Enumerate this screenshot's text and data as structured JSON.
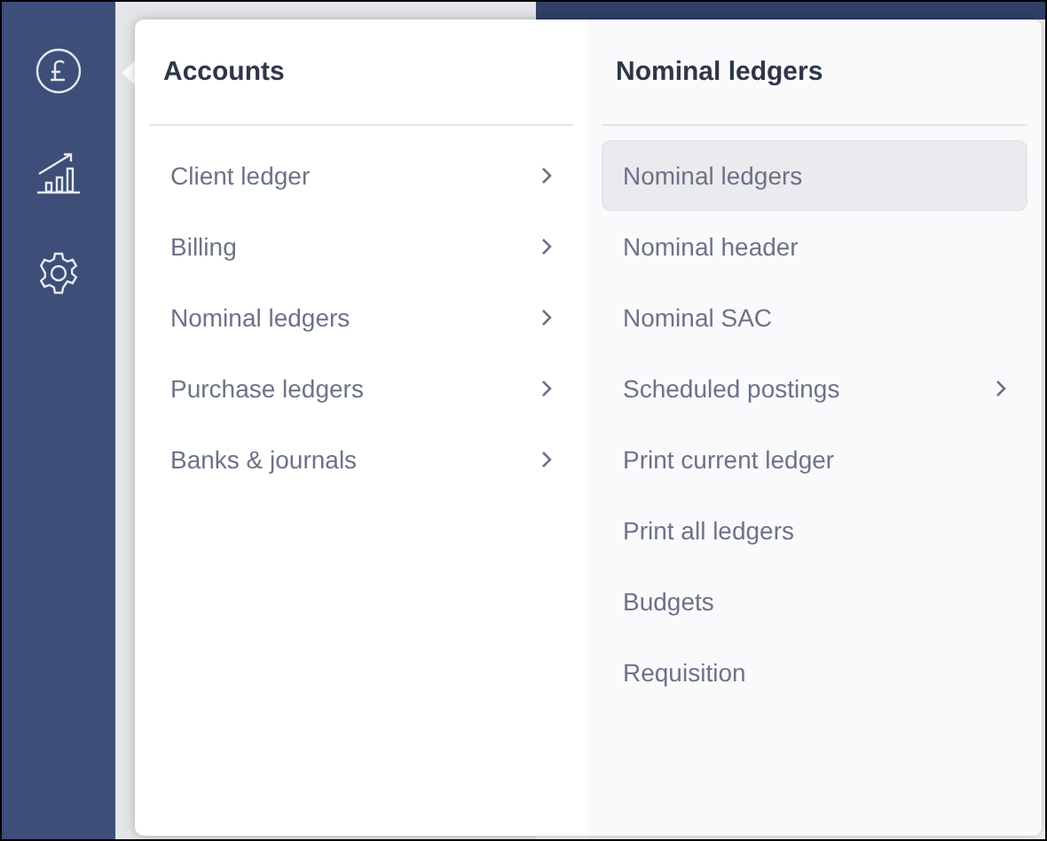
{
  "sidebar": {
    "items": [
      {
        "kind": "pound"
      },
      {
        "kind": "chart"
      },
      {
        "kind": "gear"
      }
    ]
  },
  "menu": {
    "columns": [
      {
        "title": "Accounts",
        "items": [
          {
            "label": "Client ledger",
            "selected": false,
            "has_submenu": true
          },
          {
            "label": "Billing",
            "selected": false,
            "has_submenu": true
          },
          {
            "label": "Nominal ledgers",
            "selected": false,
            "has_submenu": true
          },
          {
            "label": "Purchase ledgers",
            "selected": false,
            "has_submenu": true
          },
          {
            "label": "Banks & journals",
            "selected": false,
            "has_submenu": true
          }
        ]
      },
      {
        "title": "Nominal ledgers",
        "items": [
          {
            "label": "Nominal ledgers",
            "selected": true,
            "has_submenu": false
          },
          {
            "label": "Nominal header",
            "selected": false,
            "has_submenu": false
          },
          {
            "label": "Nominal SAC",
            "selected": false,
            "has_submenu": false
          },
          {
            "label": "Scheduled postings",
            "selected": false,
            "has_submenu": true
          },
          {
            "label": "Print current ledger",
            "selected": false,
            "has_submenu": false
          },
          {
            "label": "Print all ledgers",
            "selected": false,
            "has_submenu": false
          },
          {
            "label": "Budgets",
            "selected": false,
            "has_submenu": false
          },
          {
            "label": "Requisition",
            "selected": false,
            "has_submenu": false
          }
        ]
      }
    ]
  }
}
